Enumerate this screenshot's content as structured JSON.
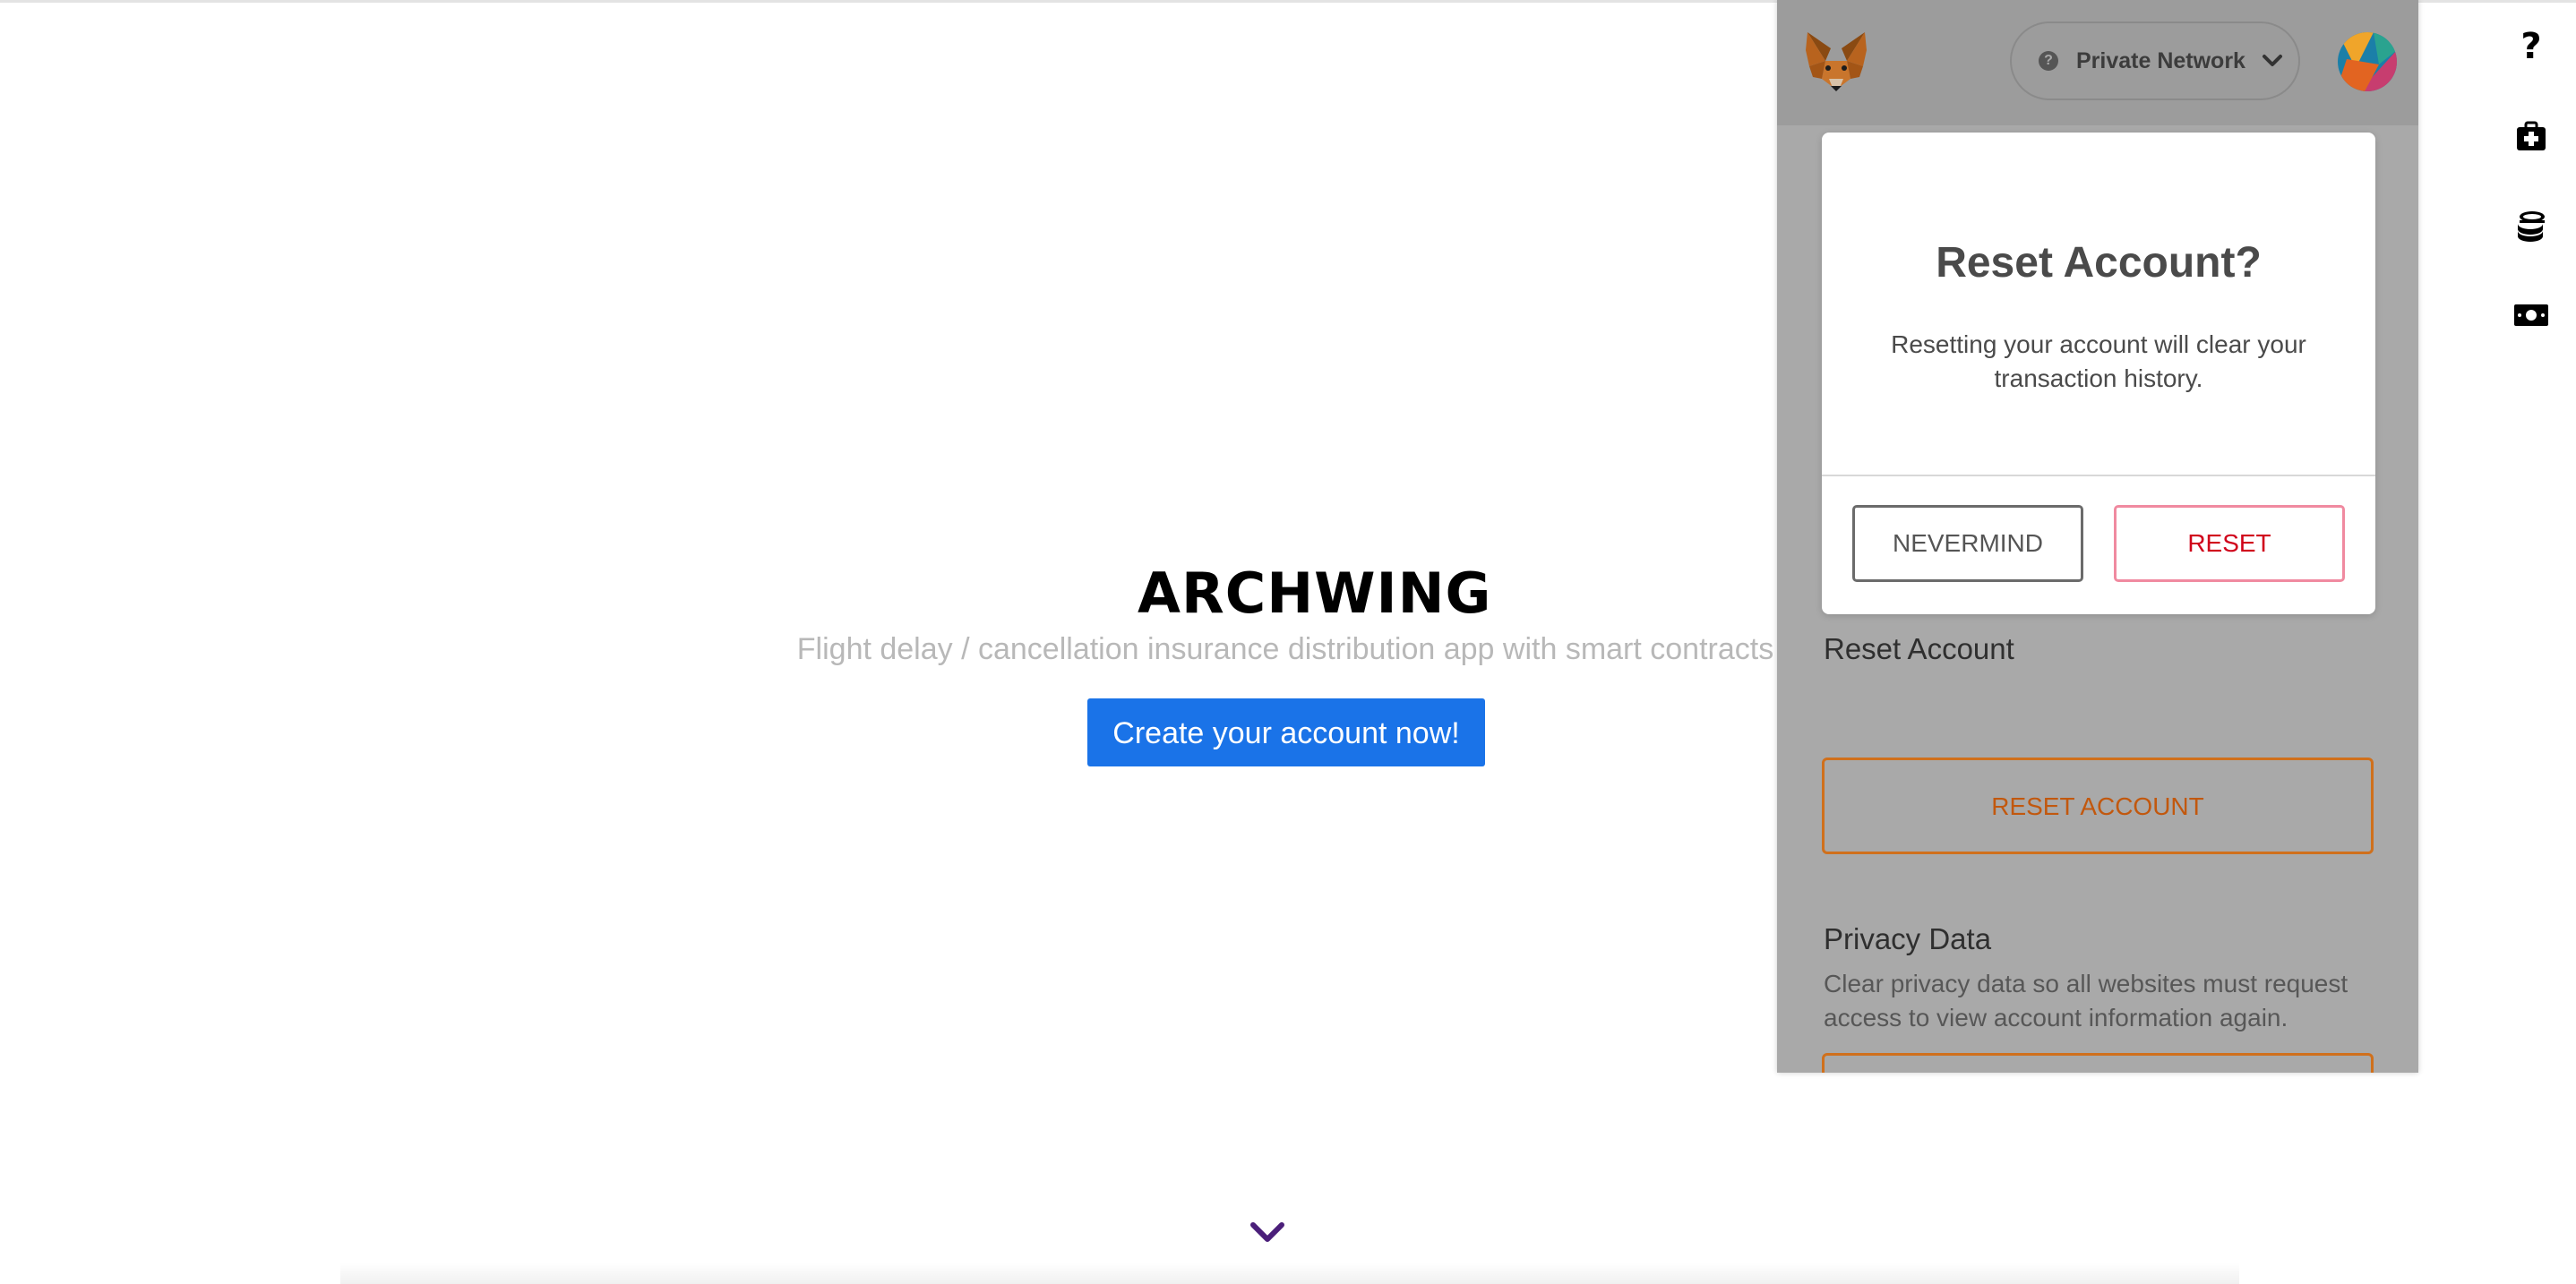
{
  "dapp": {
    "brand": "ARCHWING",
    "tagline": "Flight delay / cancellation insurance distribution app with smart contracts",
    "cta_label": "Create your account now!"
  },
  "rail": {
    "icons": [
      "help-icon",
      "medical-kit-icon",
      "coins-icon",
      "banknote-icon"
    ],
    "help_glyph": "?"
  },
  "wallet": {
    "network_label": "Private Network",
    "network_help_glyph": "?",
    "sections": {
      "reset_account_title": "Reset Account",
      "reset_account_button": "RESET ACCOUNT",
      "privacy_title": "Privacy Data",
      "privacy_desc": "Clear privacy data so all websites must request access to view account information again."
    },
    "modal": {
      "title": "Reset Account?",
      "message": "Resetting your account will clear your transaction history.",
      "cancel_label": "NEVERMIND",
      "confirm_label": "RESET"
    }
  },
  "colors": {
    "cta_blue": "#1a73e8",
    "reset_orange": "#c2580e",
    "reset_red": "#d0021b",
    "scroll_chevron": "#4b1f7a"
  }
}
